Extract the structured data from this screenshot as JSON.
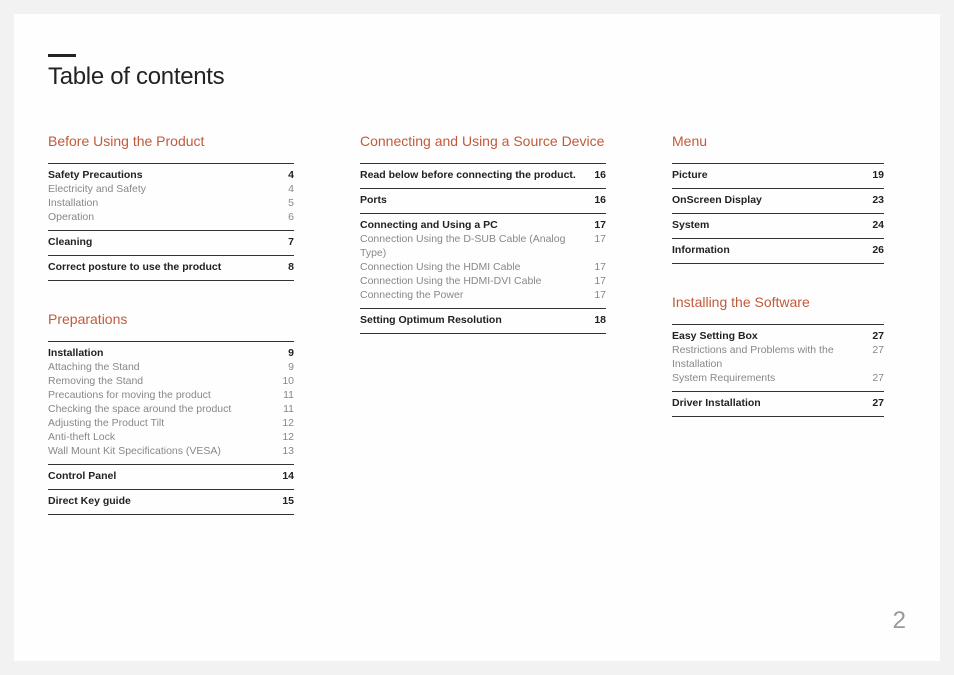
{
  "title": "Table of contents",
  "page_number": "2",
  "columns": [
    [
      {
        "heading": "Before Using the Product",
        "groups": [
          [
            {
              "bold": true,
              "label": "Safety Precautions",
              "page": "4"
            },
            {
              "bold": false,
              "label": "Electricity and Safety",
              "page": "4"
            },
            {
              "bold": false,
              "label": "Installation",
              "page": "5"
            },
            {
              "bold": false,
              "label": "Operation",
              "page": "6"
            }
          ],
          [
            {
              "bold": true,
              "label": "Cleaning",
              "page": "7"
            }
          ],
          [
            {
              "bold": true,
              "label": "Correct posture to use the product",
              "page": "8"
            }
          ]
        ]
      },
      {
        "heading": "Preparations",
        "groups": [
          [
            {
              "bold": true,
              "label": "Installation",
              "page": "9"
            },
            {
              "bold": false,
              "label": "Attaching the Stand",
              "page": "9"
            },
            {
              "bold": false,
              "label": "Removing the Stand",
              "page": "10"
            },
            {
              "bold": false,
              "label": "Precautions for moving the product",
              "page": "11"
            },
            {
              "bold": false,
              "label": "Checking the space around the product",
              "page": "11"
            },
            {
              "bold": false,
              "label": "Adjusting the Product Tilt",
              "page": "12"
            },
            {
              "bold": false,
              "label": "Anti-theft Lock",
              "page": "12"
            },
            {
              "bold": false,
              "label": "Wall Mount Kit Specifications (VESA)",
              "page": "13"
            }
          ],
          [
            {
              "bold": true,
              "label": "Control Panel",
              "page": "14"
            }
          ],
          [
            {
              "bold": true,
              "label": "Direct Key guide",
              "page": "15"
            }
          ]
        ]
      }
    ],
    [
      {
        "heading": "Connecting and Using a Source Device",
        "groups": [
          [
            {
              "bold": true,
              "label": "Read below before connecting the product.",
              "page": "16"
            }
          ],
          [
            {
              "bold": true,
              "label": "Ports",
              "page": "16"
            }
          ],
          [
            {
              "bold": true,
              "label": "Connecting and Using a PC",
              "page": "17"
            },
            {
              "bold": false,
              "label": "Connection Using the D-SUB Cable (Analog Type)",
              "page": "17"
            },
            {
              "bold": false,
              "label": "Connection Using the HDMI Cable",
              "page": "17"
            },
            {
              "bold": false,
              "label": "Connection Using the HDMI-DVI Cable",
              "page": "17"
            },
            {
              "bold": false,
              "label": "Connecting the Power",
              "page": "17"
            }
          ],
          [
            {
              "bold": true,
              "label": "Setting Optimum Resolution",
              "page": "18"
            }
          ]
        ]
      }
    ],
    [
      {
        "heading": "Menu",
        "groups": [
          [
            {
              "bold": true,
              "label": "Picture",
              "page": "19"
            }
          ],
          [
            {
              "bold": true,
              "label": "OnScreen Display",
              "page": "23"
            }
          ],
          [
            {
              "bold": true,
              "label": "System",
              "page": "24"
            }
          ],
          [
            {
              "bold": true,
              "label": "Information",
              "page": "26"
            }
          ]
        ]
      },
      {
        "heading": "Installing the Software",
        "groups": [
          [
            {
              "bold": true,
              "label": "Easy Setting Box",
              "page": "27"
            },
            {
              "bold": false,
              "label": "Restrictions and Problems with the Installation",
              "page": "27"
            },
            {
              "bold": false,
              "label": "System Requirements",
              "page": "27"
            }
          ],
          [
            {
              "bold": true,
              "label": "Driver Installation",
              "page": "27"
            }
          ]
        ]
      }
    ]
  ]
}
